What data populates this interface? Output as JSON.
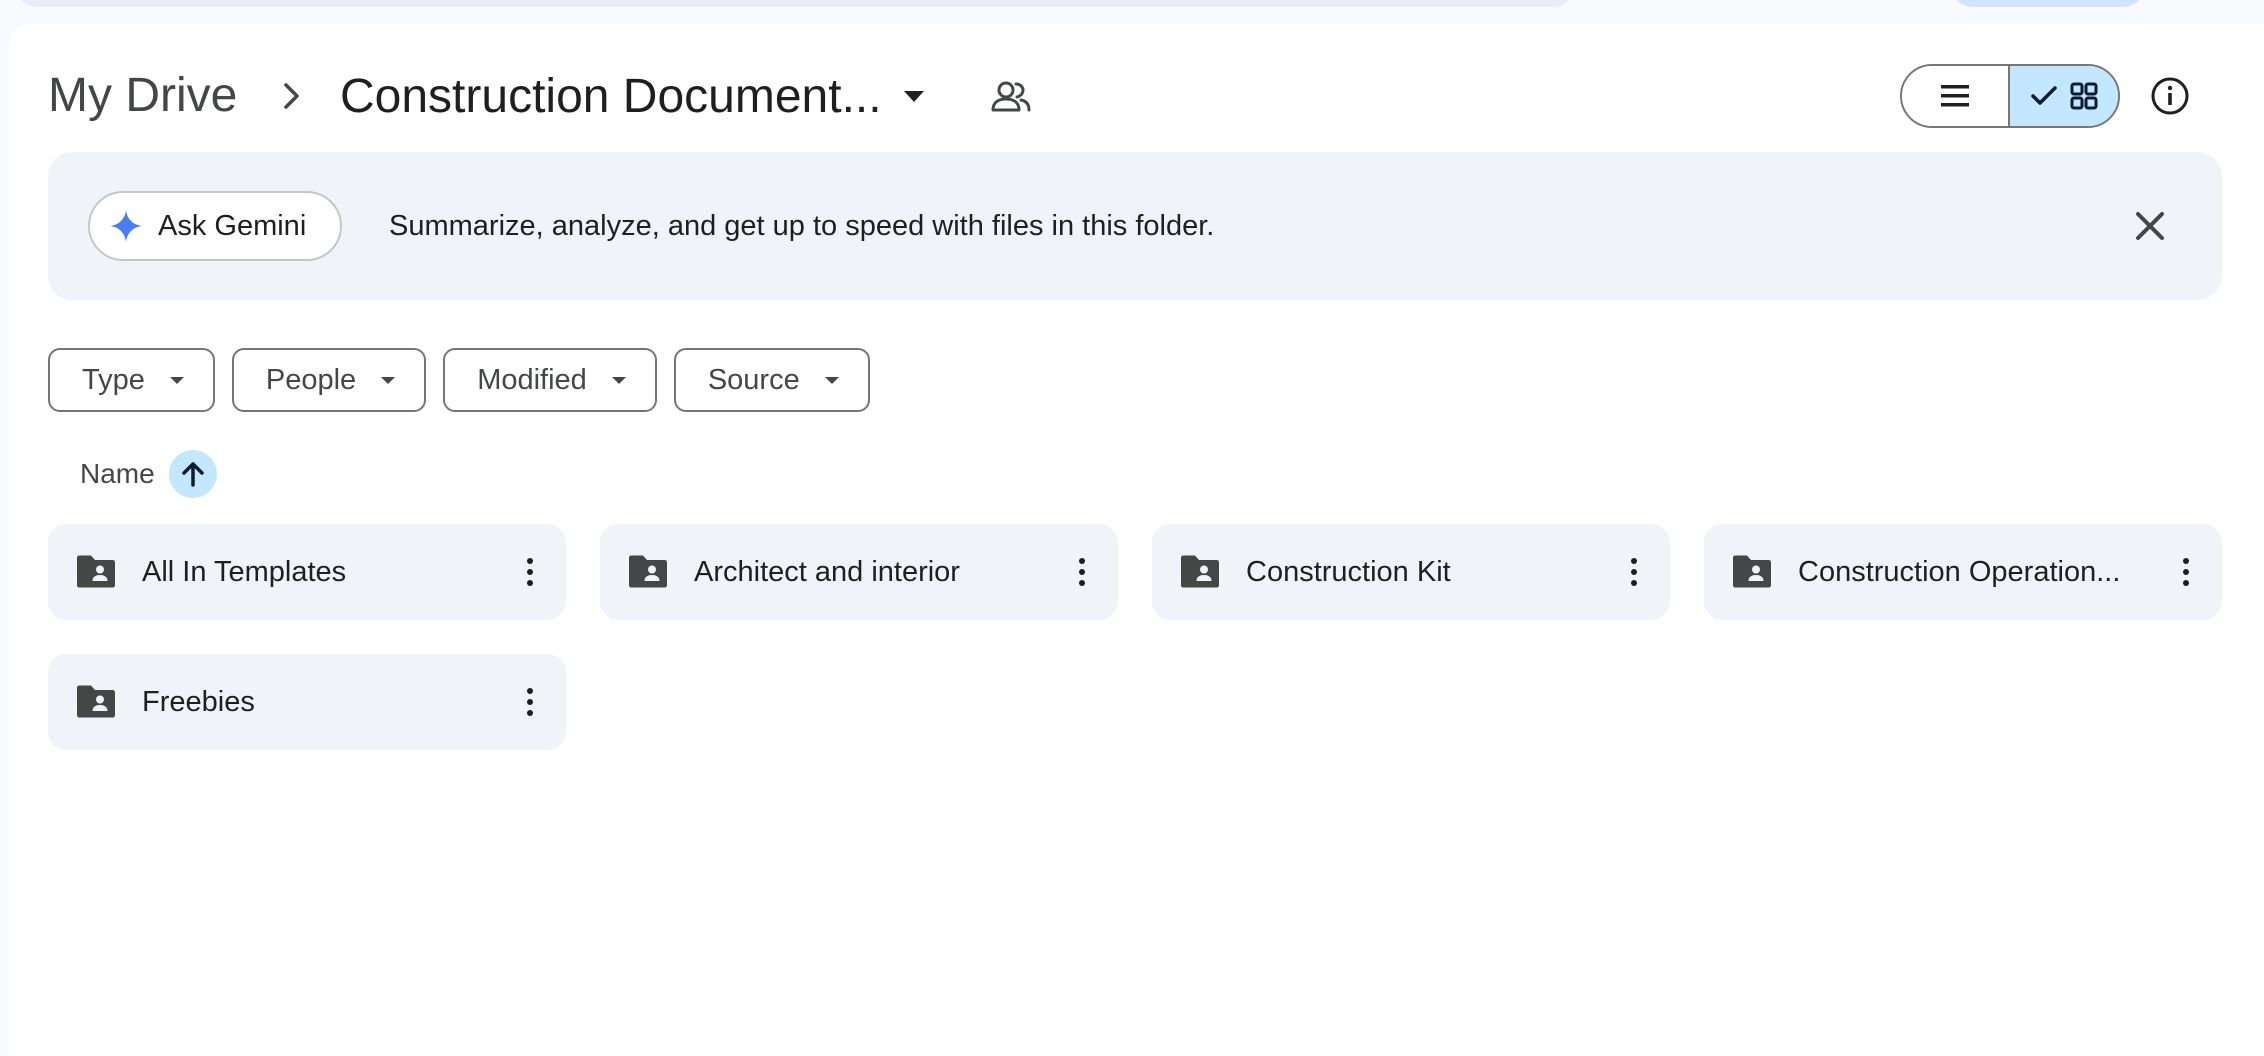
{
  "breadcrumb": {
    "root": "My Drive",
    "current": "Construction Document..."
  },
  "banner": {
    "chip_label": "Ask Gemini",
    "text": "Summarize, analyze, and get up to speed with files in this folder."
  },
  "filters": [
    {
      "label": "Type"
    },
    {
      "label": "People"
    },
    {
      "label": "Modified"
    },
    {
      "label": "Source"
    }
  ],
  "sort": {
    "label": "Name",
    "direction": "ascending"
  },
  "view": {
    "selected": "grid"
  },
  "folders": [
    {
      "name": "All In Templates"
    },
    {
      "name": "Architect and interior"
    },
    {
      "name": "Construction Kit"
    },
    {
      "name": "Construction Operation..."
    },
    {
      "name": "Freebies"
    }
  ],
  "colors": {
    "accent": "#c2e7ff",
    "banner_bg": "#f0f4f9",
    "gemini_star": "#4c7cf0",
    "icon": "#444746"
  }
}
